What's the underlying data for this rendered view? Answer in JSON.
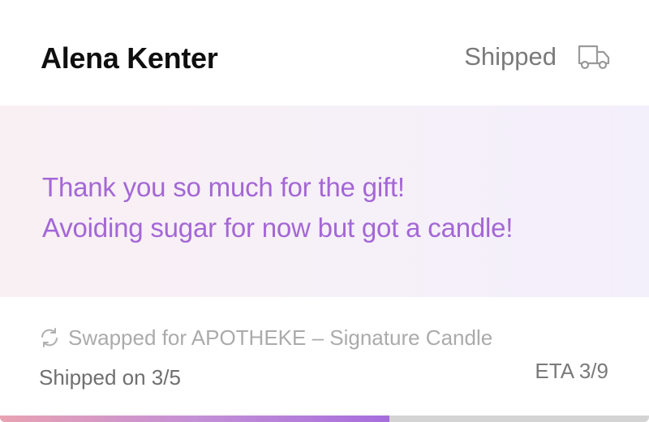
{
  "order": {
    "recipient": "Alena Kenter",
    "status": "Shipped",
    "status_icon": "truck-icon"
  },
  "message": {
    "lines": [
      "Thank you so much for the gift!",
      "Avoiding sugar for now but got a candle!"
    ],
    "color": "#a467d6"
  },
  "swap": {
    "icon": "swap-icon",
    "text": "Swapped for APOTHEKE – Signature Candle"
  },
  "shipping": {
    "shipped_on": "Shipped on 3/5",
    "eta": "ETA 3/9"
  },
  "progress": {
    "fraction": 0.6
  }
}
